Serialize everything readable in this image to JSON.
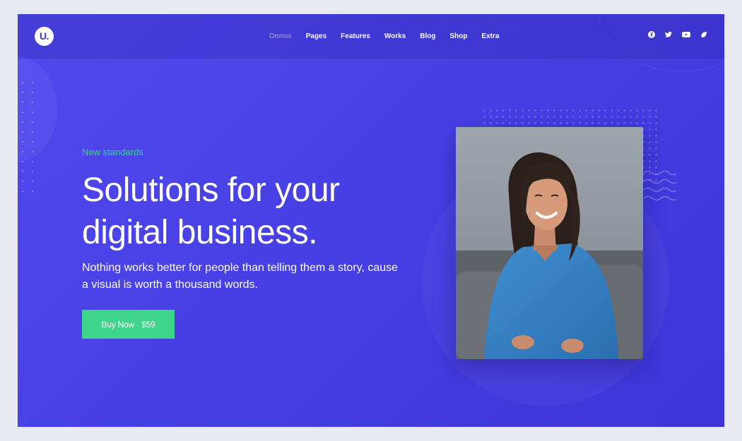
{
  "brand": {
    "logo_text": "U."
  },
  "nav": {
    "items": [
      {
        "label": "Demos",
        "active": true
      },
      {
        "label": "Pages",
        "active": false
      },
      {
        "label": "Features",
        "active": false
      },
      {
        "label": "Works",
        "active": false
      },
      {
        "label": "Blog",
        "active": false
      },
      {
        "label": "Shop",
        "active": false
      },
      {
        "label": "Extra",
        "active": false
      }
    ]
  },
  "social": {
    "icons": [
      "facebook-icon",
      "twitter-icon",
      "youtube-icon",
      "leaf-icon"
    ]
  },
  "hero": {
    "eyebrow": "New standards",
    "headline": "Solutions for your digital business.",
    "lead": "Nothing works better for people than telling them a story, cause a visual is worth a thousand words.",
    "cta_label": "Buy Now · $59"
  },
  "colors": {
    "background": "#4a43e6",
    "accent_green": "#3fd48b",
    "nav_active": "#a9a6f2",
    "text": "#ffffff"
  }
}
